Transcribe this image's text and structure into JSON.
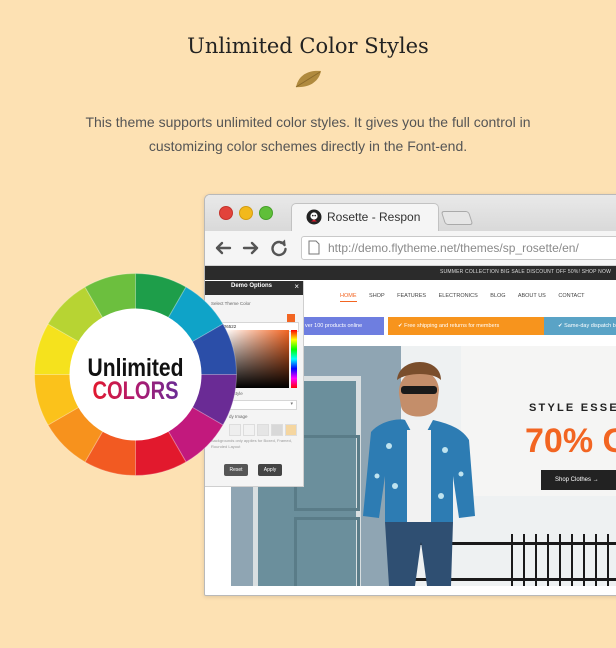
{
  "heading": "Unlimited Color Styles",
  "description": "This theme supports unlimited color styles. It gives you the full control in customizing color schemes directly in the Font-end.",
  "badge": {
    "line1": "Unlimited",
    "line2": "COLORS"
  },
  "browser": {
    "tab_title": "Rosette - Respon",
    "url": "http://demo.flytheme.net/themes/sp_rosette/en/",
    "icons": [
      "back-arrow-icon",
      "forward-arrow-icon",
      "reload-icon",
      "page-icon"
    ]
  },
  "site": {
    "promo": "SUMMER COLLECTION BIG SALE DISCOUNT OFF 50%! SHOP NOW",
    "menu": [
      "HOME",
      "SHOP",
      "FEATURES",
      "ELECTRONICS",
      "BLOG",
      "ABOUT US",
      "CONTACT"
    ],
    "features": [
      "ver 100 products online",
      "Free shipping and returns for members",
      "Same-day dispatch b"
    ],
    "hero": {
      "tagline": "STYLE ESSENT",
      "offer": "70% O",
      "button": "Shop Clothes"
    }
  },
  "demo_panel": {
    "title": "Demo Options",
    "theme_color_label": "Select Theme Color",
    "hex": "#f26522",
    "style_label": "d Style",
    "body_image_label": "dy Image",
    "note": "Backgrounds only applies for Boxed, Framed, Rounded Layout",
    "reset": "Reset",
    "apply": "Apply"
  },
  "colors": {
    "background": "#fde1b3",
    "accent": "#f26522",
    "wheel": [
      "#1e9e4a",
      "#0fa3c8",
      "#2b4ea8",
      "#6a2b95",
      "#c2197d",
      "#e2192d",
      "#f25a22",
      "#f7921d",
      "#fbc21b",
      "#f5e21d",
      "#b7d433",
      "#6cbf3e"
    ]
  }
}
